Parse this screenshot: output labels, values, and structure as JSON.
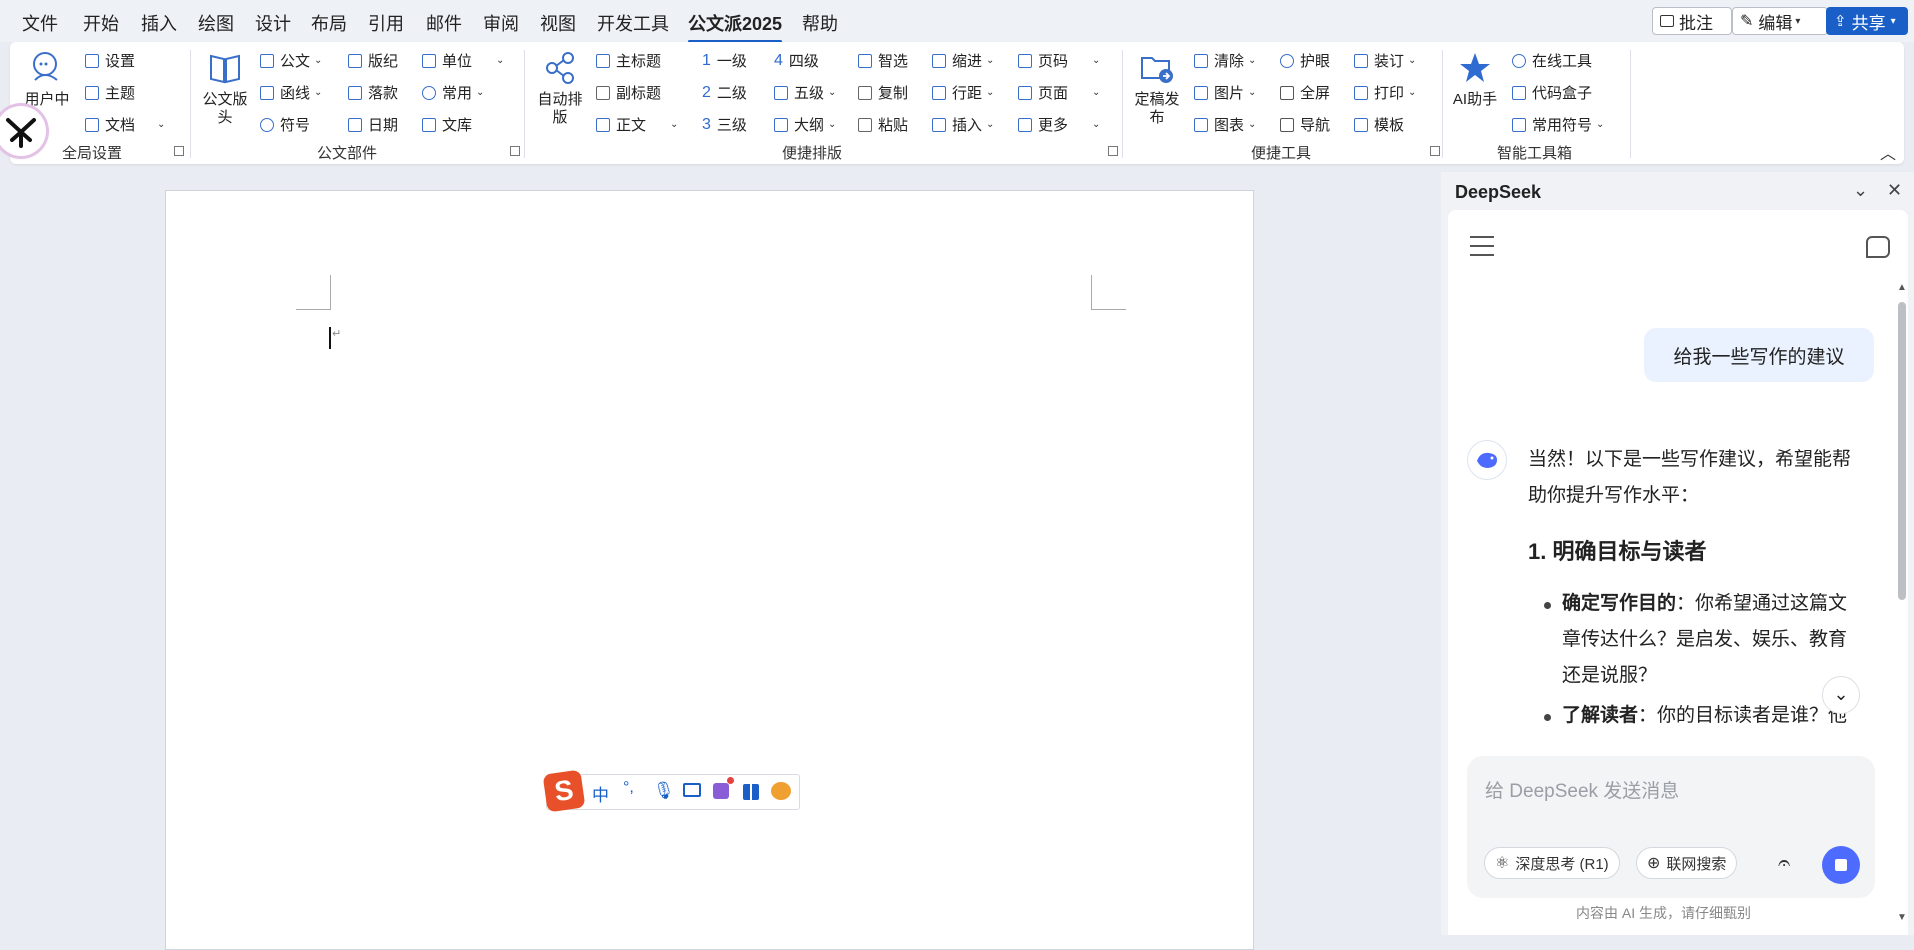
{
  "menubar": {
    "items": [
      "文件",
      "开始",
      "插入",
      "绘图",
      "设计",
      "布局",
      "引用",
      "邮件",
      "审阅",
      "视图",
      "开发工具",
      "公文派2025",
      "帮助"
    ],
    "active": "公文派2025",
    "comment_label": "批注",
    "edit_label": "编辑",
    "share_label": "共享"
  },
  "ribbon": {
    "global": {
      "user_center": "用户中心",
      "settings": "设置",
      "theme": "主题",
      "document": "文档",
      "label": "全局设置"
    },
    "parts": {
      "header": "公文版头",
      "official": "公文",
      "letter": "函线",
      "symbol": "符号",
      "edition": "版纪",
      "signature": "落款",
      "date": "日期",
      "unit": "单位",
      "common": "常用",
      "library": "文库",
      "label": "公文部件"
    },
    "layout": {
      "auto": "自动排版",
      "main_title": "主标题",
      "sub_title": "副标题",
      "body": "正文",
      "level1": "一级",
      "level2": "二级",
      "level3": "三级",
      "level4": "四级",
      "level5": "五级",
      "outline": "大纲",
      "smart_select": "智选",
      "copy": "复制",
      "paste": "粘贴",
      "indent": "缩进",
      "line_spacing": "行距",
      "insert": "插入",
      "page_number": "页码",
      "page": "页面",
      "more": "更多",
      "label": "便捷排版"
    },
    "tools": {
      "publish": "定稿发布",
      "clear": "清除",
      "image": "图片",
      "chart": "图表",
      "eye_care": "护眼",
      "fullscreen": "全屏",
      "navigation": "导航",
      "binding": "装订",
      "print": "打印",
      "template": "模板",
      "label": "便捷工具"
    },
    "ai": {
      "assistant": "AI助手",
      "online_tools": "在线工具",
      "code_box": "代码盒子",
      "common_symbols": "常用符号",
      "label": "智能工具箱"
    }
  },
  "ime": {
    "mode": "中",
    "punct": "°,"
  },
  "deepseek": {
    "title": "DeepSeek",
    "user_message": "给我一些写作的建议",
    "ai_intro_line1": "当然！以下是一些写作建议，希望能帮",
    "ai_intro_line2": "助你提升写作水平：",
    "heading1": "1. 明确目标与读者",
    "bullet1_bold": "确定写作目的",
    "bullet1_line1": "：你希望通过这篇文",
    "bullet1_line2": "章传达什么？是启发、娱乐、教育",
    "bullet1_line3": "还是说服？",
    "bullet2_bold": "了解读者",
    "bullet2_line1": "：你的目标读者是谁？他",
    "input_placeholder": "给 DeepSeek 发送消息",
    "deep_think": "深度思考 (R1)",
    "web_search": "联网搜索",
    "disclaimer": "内容由 AI 生成，请仔细甄别"
  }
}
